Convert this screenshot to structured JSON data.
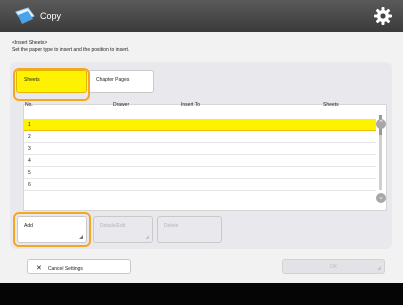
{
  "app": {
    "title": "Copy",
    "icon": "copy-app-icon"
  },
  "instructions": {
    "heading": "<Insert Sheets>",
    "text": "Set the paper type to insert and the position to insert."
  },
  "tabs": [
    {
      "label": "Sheets",
      "selected": true
    },
    {
      "label": "Chapter Pages",
      "selected": false
    }
  ],
  "table": {
    "columns": [
      "No.",
      "Drawer",
      "Insert To",
      "Sheets"
    ],
    "rows": [
      {
        "no": "1",
        "selected": true
      },
      {
        "no": "2"
      },
      {
        "no": "3"
      },
      {
        "no": "4"
      },
      {
        "no": "5"
      },
      {
        "no": "6"
      }
    ]
  },
  "actions": {
    "add": "Add",
    "details_edit": "Details/Edit",
    "delete": "Delete"
  },
  "footer": {
    "cancel_icon": "✕",
    "cancel": "Cancel Settings",
    "ok": "OK"
  },
  "colors": {
    "highlight": "#fff200",
    "focus_ring": "#f5a623",
    "titlebar": "#4a4a4a"
  }
}
